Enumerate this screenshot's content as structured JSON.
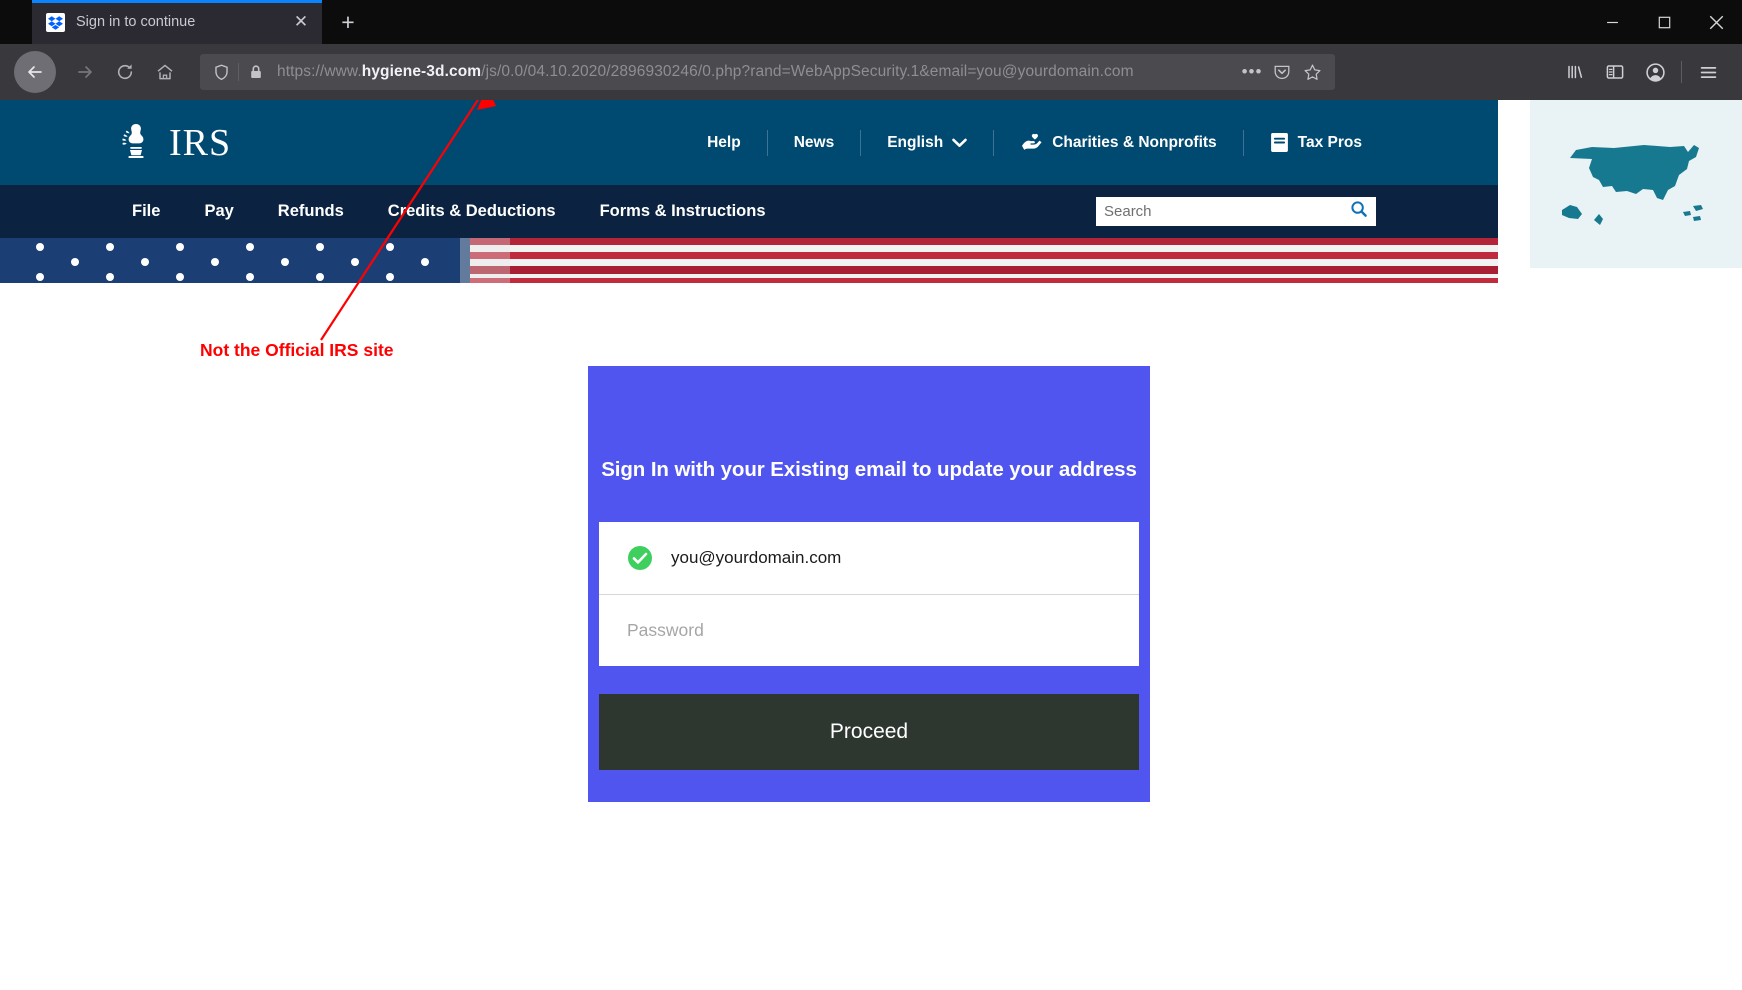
{
  "browser": {
    "tab": {
      "title": "Sign in to continue",
      "favicon": "dropbox-icon",
      "close_label": "✕"
    },
    "new_tab_label": "+",
    "window_controls": {
      "minimize": "minimize-icon",
      "maximize": "maximize-icon",
      "close": "close-icon"
    },
    "nav": {
      "back": "back-arrow-icon",
      "forward": "forward-arrow-icon",
      "reload": "reload-icon",
      "home": "home-icon"
    },
    "url": {
      "scheme": "https://www.",
      "host": "hygiene-3d.com",
      "path": "/js/0.0/04.10.2020/2896930246/0.php?rand=WebAppSecurity.1&email=you@yourdomain.com",
      "full": "https://www.hygiene-3d.com/js/0.0/04.10.2020/2896930246/0.php?rand=WebAppSecurity.1&email=you@yourdomain.com",
      "shield_icon": "tracking-protection-shield-icon",
      "lock_icon": "padlock-icon",
      "page_actions": "•••",
      "pocket_icon": "pocket-icon",
      "bookmark_icon": "star-icon"
    },
    "toolbar_right": {
      "library": "library-icon",
      "sidebar": "sidebar-icon",
      "account": "account-icon",
      "menu": "hamburger-menu-icon"
    }
  },
  "irs": {
    "logo_text": "IRS",
    "top_links": [
      {
        "label": "Help",
        "icon": null
      },
      {
        "label": "News",
        "icon": null
      },
      {
        "label": "English",
        "icon": "chevron-down-icon"
      },
      {
        "label": "Charities & Nonprofits",
        "icon": "charities-icon"
      },
      {
        "label": "Tax Pros",
        "icon": "tax-pros-icon"
      }
    ],
    "nav_links": [
      "File",
      "Pay",
      "Refunds",
      "Credits & Deductions",
      "Forms & Instructions"
    ],
    "search": {
      "placeholder": "Search",
      "value": "",
      "icon": "search-icon"
    },
    "map_panel": {
      "alt": "us-map-icon"
    },
    "colors": {
      "topbar": "#004971",
      "nav": "#0b2340",
      "map_fill": "#16798f",
      "map_bg": "#e9f2f4"
    }
  },
  "annotation": {
    "text": "Not the Official IRS site",
    "color": "#ff0000"
  },
  "signin": {
    "title": "Sign In with your Existing email to update your address",
    "email": {
      "value": "you@yourdomain.com",
      "verified_icon": "green-check-circle-icon"
    },
    "password": {
      "value": "",
      "placeholder": "Password"
    },
    "submit_label": "Proceed",
    "colors": {
      "card": "#5055f0",
      "button": "#2d3730",
      "check": "#3ecf5e"
    }
  }
}
